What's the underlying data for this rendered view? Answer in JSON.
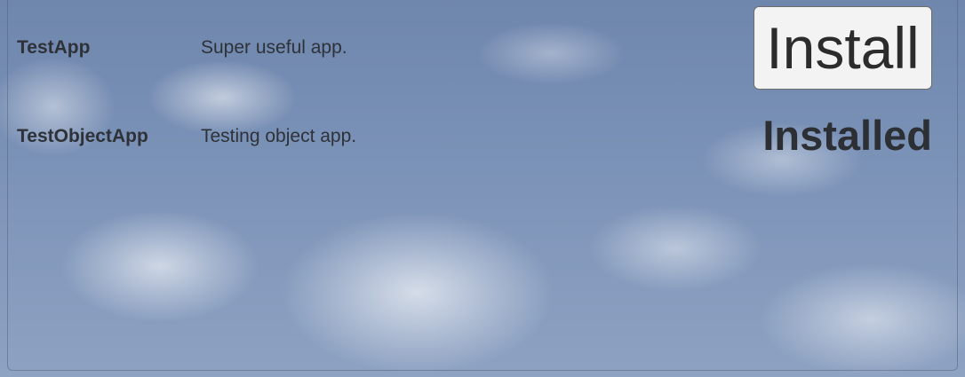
{
  "apps": [
    {
      "name": "TestApp",
      "description": "Super useful app.",
      "action_label": "Install"
    },
    {
      "name": "TestObjectApp",
      "description": "Testing object app.",
      "status_label": "Installed"
    }
  ]
}
